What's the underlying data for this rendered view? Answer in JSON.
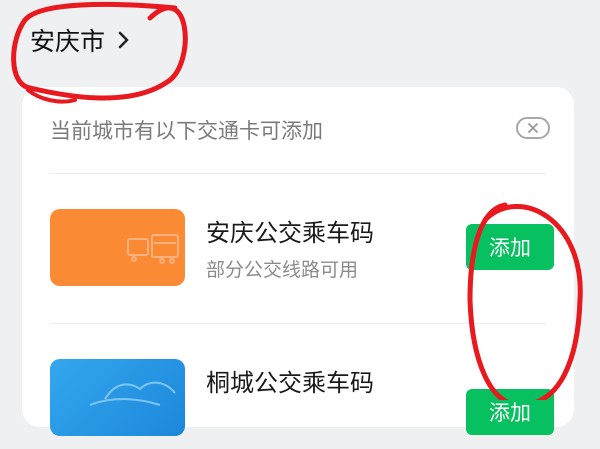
{
  "header": {
    "city": "安庆市"
  },
  "card": {
    "hint": "当前城市有以下交通卡可添加",
    "items": [
      {
        "title": "安庆公交乘车码",
        "subtitle": "部分公交线路可用",
        "button": "添加"
      },
      {
        "title": "桐城公交乘车码",
        "subtitle": "",
        "button": "添加"
      }
    ]
  },
  "colors": {
    "accent_green": "#07c160",
    "card_orange": "#fb8a35",
    "card_blue": "#2a9ae6",
    "annotation_red": "#e8191f"
  },
  "icons": [
    "chevron-right-icon",
    "close-icon",
    "bus-icon",
    "hills-icon"
  ]
}
